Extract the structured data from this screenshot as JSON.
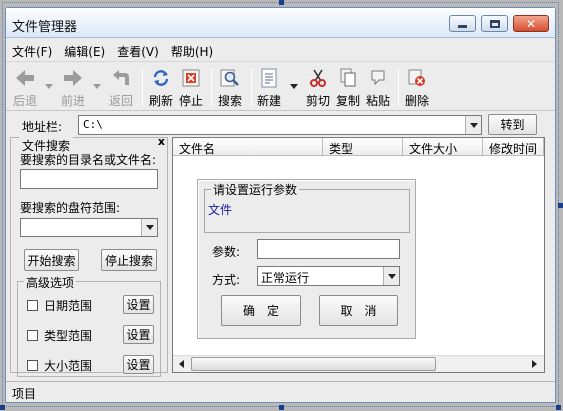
{
  "window": {
    "title": "文件管理器"
  },
  "menu": [
    "文件(F)",
    "编辑(E)",
    "查看(V)",
    "帮助(H)"
  ],
  "toolbar": {
    "back": "后退",
    "forward": "前进",
    "up": "返回",
    "refresh": "刷新",
    "stop": "停止",
    "search": "搜索",
    "new": "新建",
    "cut": "剪切",
    "copy": "复制",
    "paste": "粘贴",
    "delete": "删除"
  },
  "address": {
    "label": "地址栏:",
    "value": "C:\\",
    "go": "转到"
  },
  "search_panel": {
    "title": "文件搜索",
    "close": "x",
    "target_label": "要搜索的目录名或文件名:",
    "target_value": "",
    "drive_label": "要搜索的盘符范围:",
    "drive_value": "",
    "start": "开始搜索",
    "stop": "停止搜索",
    "advanced_title": "高级选项",
    "options": [
      {
        "label": "日期范围",
        "button": "设置"
      },
      {
        "label": "类型范围",
        "button": "设置"
      },
      {
        "label": "大小范围",
        "button": "设置"
      }
    ]
  },
  "file_list": {
    "columns": [
      "文件名",
      "类型",
      "文件大小",
      "修改时间"
    ]
  },
  "dialog": {
    "group_title": "请设置运行参数",
    "group_text": "文件",
    "param_label": "参数:",
    "param_value": "",
    "mode_label": "方式:",
    "mode_value": "正常运行",
    "ok": "确　定",
    "cancel": "取　消"
  },
  "status": {
    "text": "项目"
  },
  "colors": {
    "title_gradient_top": "#fdfeff",
    "title_gradient_bottom": "#dbe8f7",
    "window_bg": "#ececec",
    "design_bg": "#b9b9b9",
    "group_text": "#1a1aa0"
  }
}
